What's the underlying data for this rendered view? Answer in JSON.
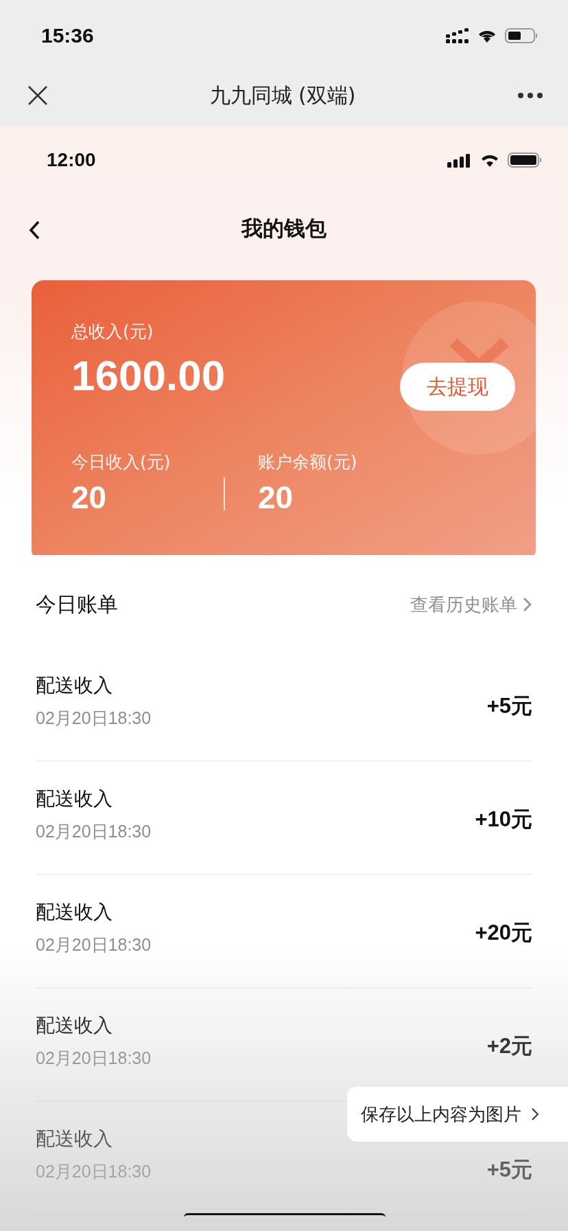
{
  "outer_status_bar": {
    "time": "15:36"
  },
  "mini_program_bar": {
    "title": "九九同城 (双端)"
  },
  "inner_status_bar": {
    "time": "12:00"
  },
  "nav_bar": {
    "title": "我的钱包"
  },
  "wallet_card": {
    "total_label": "总收入(元)",
    "total_value": "1600.00",
    "withdraw_button": "去提现",
    "stats": [
      {
        "label": "今日收入(元)",
        "value": "20"
      },
      {
        "label": "账户余额(元)",
        "value": "20"
      }
    ]
  },
  "bills": {
    "title": "今日账单",
    "history_link": "查看历史账单",
    "rows": [
      {
        "title": "配送收入",
        "time": "02月20日18:30",
        "amount": "+5元"
      },
      {
        "title": "配送收入",
        "time": "02月20日18:30",
        "amount": "+10元"
      },
      {
        "title": "配送收入",
        "time": "02月20日18:30",
        "amount": "+20元"
      },
      {
        "title": "配送收入",
        "time": "02月20日18:30",
        "amount": "+2元"
      },
      {
        "title": "配送收入",
        "time": "02月20日18:30",
        "amount": "+5元"
      }
    ]
  },
  "save_popup": {
    "label": "保存以上内容为图片"
  }
}
